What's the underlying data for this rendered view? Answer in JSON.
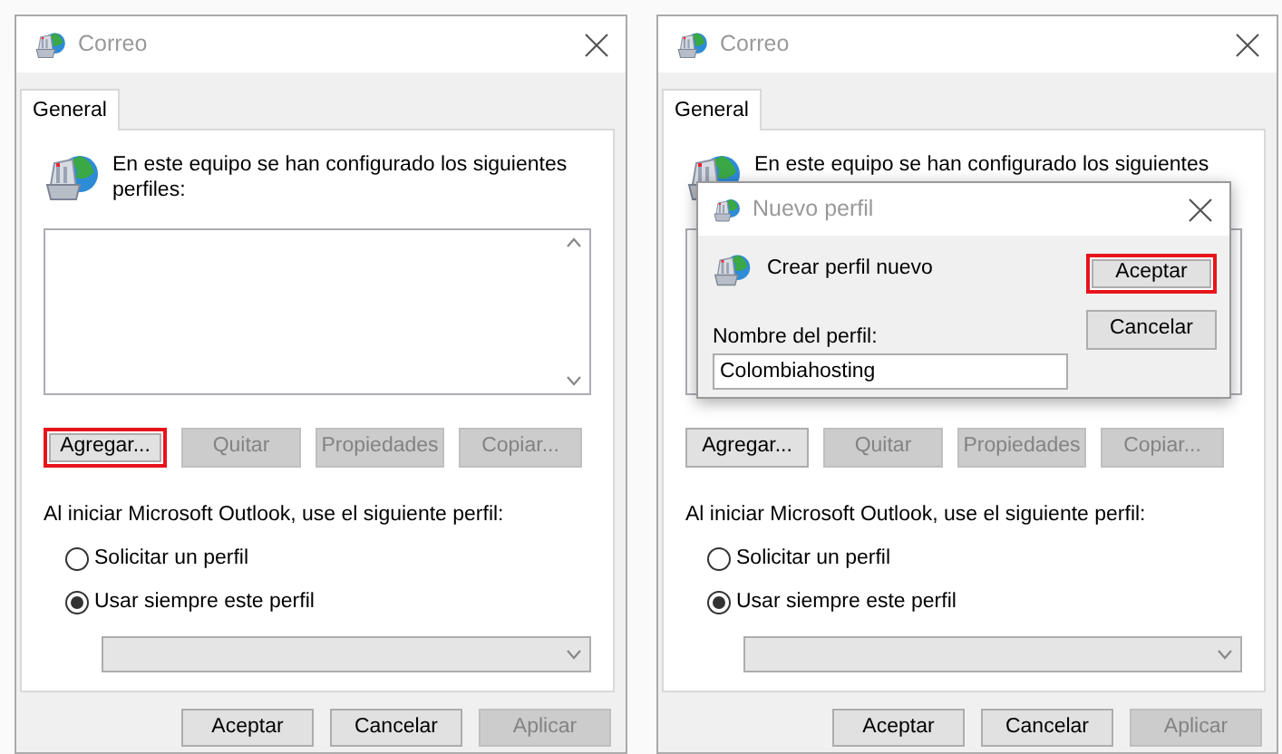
{
  "dialogs": [
    {
      "title": "Correo",
      "tab": {
        "label": "General",
        "selected": true
      },
      "heading": "En este equipo se han configurado los siguientes perfiles:",
      "buttons": [
        {
          "label": "Agregar...",
          "disabled": false,
          "highlighted": true
        },
        {
          "label": "Quitar",
          "disabled": true,
          "highlighted": false
        },
        {
          "label": "Propiedades",
          "disabled": true,
          "highlighted": false
        },
        {
          "label": "Copiar...",
          "disabled": true,
          "highlighted": false
        }
      ],
      "startup_label": "Al iniciar Microsoft Outlook, use el siguiente perfil:",
      "options": [
        {
          "label": "Solicitar un perfil",
          "selected": false
        },
        {
          "label": "Usar siempre este perfil",
          "selected": true
        }
      ],
      "footer_buttons": [
        {
          "label": "Aceptar",
          "disabled": false
        },
        {
          "label": "Cancelar",
          "disabled": false
        },
        {
          "label": "Aplicar",
          "disabled": true
        }
      ]
    },
    {
      "title": "Correo",
      "tab": {
        "label": "General",
        "selected": true
      },
      "heading": "En este equipo se han configurado los siguientes",
      "buttons": [
        {
          "label": "Agregar...",
          "disabled": false,
          "highlighted": false
        },
        {
          "label": "Quitar",
          "disabled": true,
          "highlighted": false
        },
        {
          "label": "Propiedades",
          "disabled": true,
          "highlighted": false
        },
        {
          "label": "Copiar...",
          "disabled": true,
          "highlighted": false
        }
      ],
      "startup_label": "Al iniciar Microsoft Outlook, use el siguiente perfil:",
      "options": [
        {
          "label": "Solicitar un perfil",
          "selected": false
        },
        {
          "label": "Usar siempre este perfil",
          "selected": true
        }
      ],
      "footer_buttons": [
        {
          "label": "Aceptar",
          "disabled": false
        },
        {
          "label": "Cancelar",
          "disabled": false
        },
        {
          "label": "Aplicar",
          "disabled": true
        }
      ],
      "popup": {
        "title": "Nuevo perfil",
        "message": "Crear perfil nuevo",
        "field_label": "Nombre del perfil:",
        "value": "Colombiahosting",
        "buttons": [
          {
            "label": "Aceptar",
            "highlighted": true
          },
          {
            "label": "Cancelar",
            "highlighted": false
          }
        ]
      }
    }
  ]
}
